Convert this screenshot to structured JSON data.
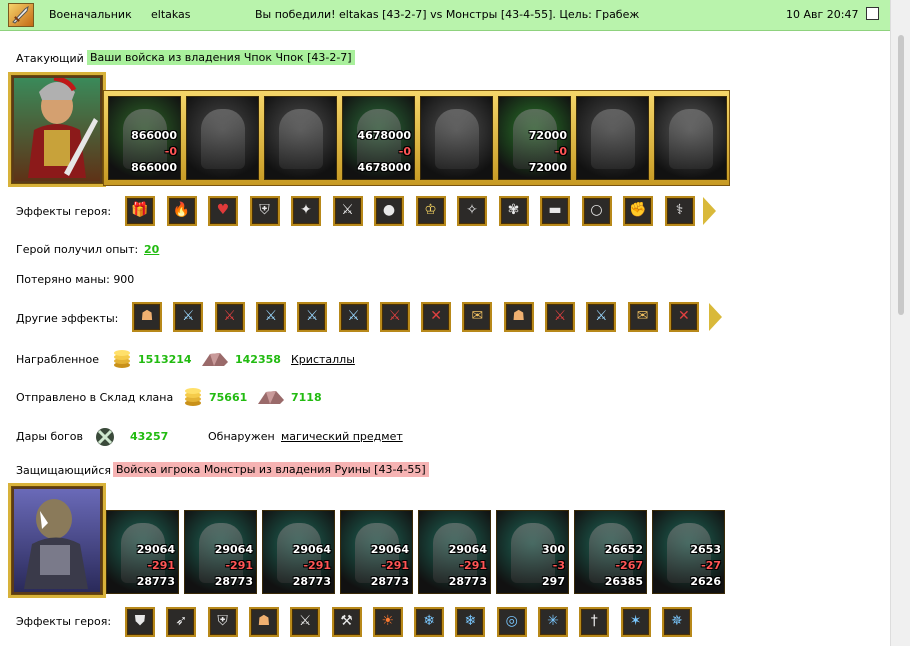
{
  "topbar": {
    "role": "Военачальник",
    "player": "eltakas",
    "title": "Вы победили! eltakas [43-2-7] vs Монстры [43-4-55]. Цель: Грабеж",
    "datetime": "10 Авг 20:47"
  },
  "attacker": {
    "label": "Атакующий",
    "tag": "Ваши войска из владения Чпок Чпок [43-2-7]",
    "units": [
      {
        "top": "866000",
        "mid": "-0",
        "bottom": "866000",
        "color": "#2f6b2a"
      },
      {
        "top": "",
        "mid": "",
        "bottom": "",
        "color": "#4a4a4a"
      },
      {
        "top": "",
        "mid": "",
        "bottom": "",
        "color": "#4f4f4f"
      },
      {
        "top": "4678000",
        "mid": "-0",
        "bottom": "4678000",
        "color": "#2c6e3a"
      },
      {
        "top": "",
        "mid": "",
        "bottom": "",
        "color": "#505050"
      },
      {
        "top": "72000",
        "mid": "-0",
        "bottom": "72000",
        "color": "#2a7a2a"
      },
      {
        "top": "",
        "mid": "",
        "bottom": "",
        "color": "#4a4a4a"
      },
      {
        "top": "",
        "mid": "",
        "bottom": "",
        "color": "#5a5a5a"
      }
    ]
  },
  "hero_effects_label": "Эффекты героя:",
  "hero_effects_icons": [
    "gift-icon",
    "fire-chest-icon",
    "heart-icon",
    "shield-icon",
    "treasure-icon",
    "armor-icon",
    "potion-icon",
    "crown-icon",
    "amulet-icon",
    "wings-icon",
    "belt-icon",
    "ring-icon",
    "gauntlet-icon",
    "staff-icon"
  ],
  "exp": {
    "label": "Герой получил опыт:",
    "value": "20"
  },
  "mana": {
    "label": "Потеряно маны: 900"
  },
  "other_effects_label": "Другие эффекты:",
  "other_effects_icons": [
    "warrior-icon",
    "sword-icon",
    "red-sword-icon",
    "sword-icon",
    "sword-icon",
    "sword-icon",
    "red-sword-icon",
    "red-axe-icon",
    "scroll-icon",
    "warrior-icon",
    "red-sword-icon",
    "sword-icon",
    "scroll-icon",
    "red-axe-icon"
  ],
  "loot": {
    "label": "Награбленное",
    "gold": "1513214",
    "crystals": "142358",
    "crystals_link": "Кристаллы"
  },
  "clan": {
    "label": "Отправлено в Склад клана",
    "gold": "75661",
    "crystals": "7118"
  },
  "gifts": {
    "label": "Дары богов",
    "value": "43257",
    "found_label": "Обнаружен",
    "found_link": "магический предмет"
  },
  "defender": {
    "label": "Защищающийся",
    "tag": "Войска игрока Монстры из владения Руины [43-4-55]",
    "units": [
      {
        "top": "29064",
        "mid": "-291",
        "bottom": "28773",
        "color": "#1e6a5a"
      },
      {
        "top": "29064",
        "mid": "-291",
        "bottom": "28773",
        "color": "#1e6a5a"
      },
      {
        "top": "29064",
        "mid": "-291",
        "bottom": "28773",
        "color": "#1e6a5a"
      },
      {
        "top": "29064",
        "mid": "-291",
        "bottom": "28773",
        "color": "#1e6a5a"
      },
      {
        "top": "29064",
        "mid": "-291",
        "bottom": "28773",
        "color": "#1e6a5a"
      },
      {
        "top": "300",
        "mid": "-3",
        "bottom": "297",
        "color": "#1e6a5a"
      },
      {
        "top": "26652",
        "mid": "-267",
        "bottom": "26385",
        "color": "#1e6a5a"
      },
      {
        "top": "2653",
        "mid": "-27",
        "bottom": "2626",
        "color": "#1e6a5a"
      }
    ]
  },
  "def_effects_label": "Эффекты героя:",
  "def_effects_icons": [
    "cloak-icon",
    "spear-icon",
    "shield-icon",
    "warrior-icon",
    "armor-icon",
    "hammer-icon",
    "lion-icon",
    "ice-armor-icon",
    "ice-armor-icon",
    "ice-ring-icon",
    "ice-staff-icon",
    "mace-icon",
    "ice-crystal-icon",
    "ice-mage-icon"
  ]
}
